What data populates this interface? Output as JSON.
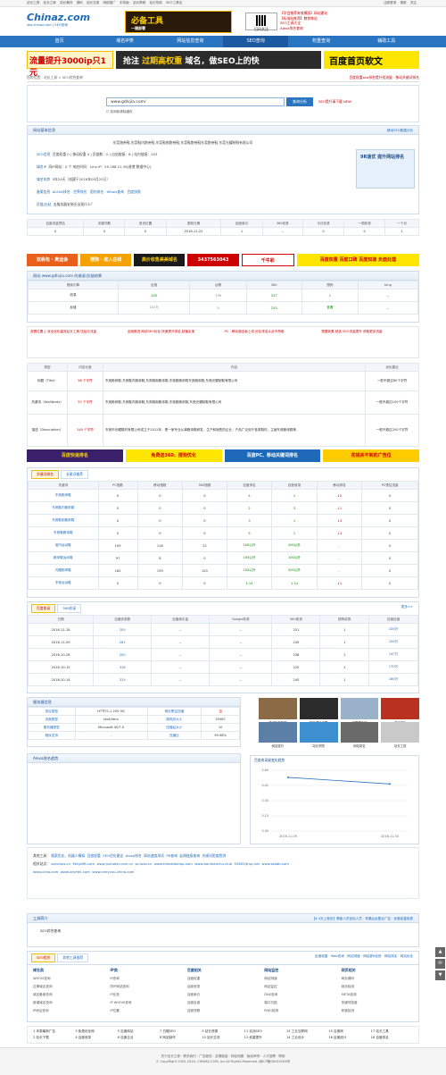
{
  "topbar": {
    "left": [
      "站长工具",
      "站长之家",
      "站长素材",
      "源码",
      "站长交易",
      "网络推广",
      "手机版",
      "站长帮助",
      "站长导航",
      "SEO工具包"
    ],
    "right": [
      "注册登录",
      "更新",
      "关注"
    ]
  },
  "header": {
    "logo_text": "Chinaz.com",
    "logo_sub": "seo.chinaz.com | SEO查询",
    "ad_title": "必备工具",
    "ad_sub": "一键部署",
    "qr_label": "扫码关注",
    "links": [
      "【学会推荐有效模版】网站建站",
      "【标准站推荐】教你做站",
      "SEO工具大全",
      "Alexa排名查询",
      "网站被K监控",
      "seo优化教程"
    ]
  },
  "nav": [
    "首页",
    "域名IP类",
    "网站信息查询",
    "SEO查询",
    "权重查询",
    "辅助工具"
  ],
  "banners": {
    "b1": "流量提升3000ip只1元",
    "b2_a": "抢注",
    "b2_b": "过期高权重",
    "b2_c": "域名，做SEO上的快",
    "b3": "百度首页软文"
  },
  "crumb": {
    "text": "您的位置：站长工具 > SEO综合查询",
    "right": "百度权重seo排名提升找流量 · 移动关键词排名"
  },
  "search": {
    "value": "www.gdlvjia.com/",
    "button": "查询分析",
    "note": "SEO提升请下载 NEW",
    "checkbox": "查询前清除缓存"
  },
  "basic": {
    "title": "网站基本信息",
    "right": "移动SEO数据分析",
    "keywords": "东莞跑帝鞋,东莞鞋内跑帝鞋,东莞鞋制跑帝鞋,东莞鞋跑帝鞋东莞跑帝鞋,东莞光耀制鞋有限公司",
    "seo_label": "SEO信息",
    "seo_text": "百度权重 0 | 移动权重 0 | 反链数：0 | 出站链接：8 | 站内链接：203",
    "ip_label": "域名IP",
    "ip_text": "同IP网站：0 个   响应时间：1ms   IP：59.188.21.39[香港 数据中心]",
    "age_label": "域名年龄",
    "age_text": "5年29天（创建于2016年05月25日）",
    "record_label": "备案信息",
    "record_text": "ALEXA排名 · 世界排名 · 国内排名 · Whois查询 · 百度快照",
    "speed_label": "反链/出站",
    "speed_text": "去服务器安装还出现什么？",
    "ad_box": "9R速优 提升网站排名"
  },
  "stats_table": {
    "headers": [
      "百度流量预估",
      "关键词数",
      "首页位置",
      "更新日期",
      "百度索引",
      "360收录",
      "今日收录",
      "一周收录",
      "一个月"
    ],
    "values": [
      "0",
      "0",
      "0",
      "2016-11-22",
      "1",
      "--",
      "0",
      "0",
      "1"
    ]
  },
  "ads_row1": [
    "双肩包 · 奥运会",
    "搜狗 · 收入在线",
    "高价收售美美域名",
    "3437563043",
    "千牛彩",
    "百度权重 百度口碑 百度知道 负面处理"
  ],
  "include": {
    "title": "网站 www.gdlvjia.com 的收录/反链结果",
    "headers": [
      "搜索引擎",
      "百度",
      "谷歌",
      "360",
      "搜狗",
      "bing"
    ],
    "rows": [
      [
        "收录",
        "205",
        "199",
        "257",
        "1",
        "--"
      ],
      [
        "反链",
        "102万",
        "0",
        "253",
        "查看",
        "--"
      ]
    ]
  },
  "promo": [
    "查看位置上 双全优化高效站长工具 伍拾元流量",
    "全面推进 网站SEO优化 快速提升排名 超值实惠",
    "PC - 移动端全面上线 优化排名从此不再难",
    "想要效果 就选 SEO流量提升 获取更多流量"
  ],
  "meta": {
    "headers": [
      "类型",
      "内容长度",
      "内容",
      "优化建议"
    ],
    "rows": [
      [
        "标题（Title）",
        "56 个字符",
        "东莞跑帝鞋,东莞鞋内跑帝鞋,东莞鞋制跑帝鞋,东莞鞋跑帝鞋东莞跑帝鞋,东莞光耀制鞋有限公司",
        "一般不超过80个字符"
      ],
      [
        "关键词（KeyWords）",
        "57 个字符",
        "东莞跑帝鞋,东莞鞋内跑帝鞋,东莞鞋制跑帝鞋,东莞鞋跑帝鞋,东莞光耀制鞋有限公司",
        "一般不超过100个字符"
      ],
      [
        "描述（Description）",
        "140 个字符",
        "东莞市光耀鞋材有限公司成立于2012年，是一家专业从事跑帝鞋研发、生产和销售的企业，产品广泛用于各类鞋材，主营东莞跑帝鞋等。",
        "一般不超过200个字符"
      ]
    ]
  },
  "ads_row2": [
    "百度快速排名",
    "免费送360、搜狗优化",
    "百度PC、移动关键词排名",
    "花钱买不到的广告位"
  ],
  "kw": {
    "tabs": [
      "关键词排名",
      "长尾词推荐"
    ],
    "headers": [
      "关键词",
      "PC指数",
      "移动指数",
      "360指数",
      "百度排名",
      "百度收录",
      "移动排名",
      "PC预估流量",
      "预估流量"
    ],
    "rows": [
      [
        "东莞跑帝鞋",
        "0",
        "0",
        "0",
        "4",
        "1",
        "↓2",
        "0"
      ],
      [
        "东莞鞋内跑帝鞋",
        "0",
        "0",
        "0",
        "2",
        "3",
        "↓1",
        "0"
      ],
      [
        "东莞鞋制跑帝鞋",
        "0",
        "0",
        "0",
        "3",
        "1",
        "↓3",
        "0"
      ],
      [
        "东莞鞋跑帝鞋",
        "0",
        "0",
        "0",
        "5",
        "1",
        "↓3",
        "0"
      ],
      [
        "室内运动鞋",
        "109",
        "118",
        "22",
        "100以外",
        "100以外",
        "-",
        "0"
      ],
      [
        "跑帝鞋运动鞋",
        "97",
        "8",
        "0",
        "100以外",
        "100以外",
        "-",
        "0"
      ],
      [
        "光耀跑帝鞋",
        "182",
        "159",
        "120",
        "100以外",
        "100以外",
        "-",
        "0"
      ],
      [
        "东莞运动鞋",
        "0",
        "0",
        "0",
        "1.14",
        "1.14",
        "↓1",
        "0"
      ]
    ]
  },
  "hist": {
    "tabs": [
      "百度收录",
      "360收录"
    ],
    "right": "更多>>",
    "headers": [
      "日期",
      "百度收录数",
      "百度索引量",
      "Google收录",
      "360收录",
      "搜狗收录",
      "百度反链"
    ],
    "rows": [
      [
        "2016-11-18",
        "205",
        "--",
        "--",
        "251",
        "1",
        "100万"
      ],
      [
        "2016-11-09",
        "261",
        "--",
        "--",
        "245",
        "1",
        "100万"
      ],
      [
        "2016-10-28",
        "200",
        "--",
        "--",
        "238",
        "1",
        "147万"
      ],
      [
        "2016-10-15",
        "316",
        "--",
        "--",
        "220",
        "1",
        "170万"
      ],
      [
        "2016-10-14",
        "315",
        "--",
        "--",
        "245",
        "1",
        "180万"
      ]
    ]
  },
  "server": {
    "title": "服务器信息",
    "rows": [
      [
        "协议类型",
        "HTTP/1.1 200 OK",
        "网页是否压缩",
        "否"
      ],
      [
        "页面类型",
        "text/html",
        "原网页大小",
        "55587"
      ],
      [
        "服务器类型",
        "Microsoft-IIS/7.0",
        "压缩后大小",
        "10"
      ],
      [
        "程序支持",
        "-",
        "压缩比",
        "99.98%"
      ]
    ],
    "thumbs": [
      "热门软件推荐",
      "精品源码下载",
      "中国建站师",
      "游戏排行",
      "网站技巧",
      "站长学院",
      "网站排名",
      "站长工具",
      "SEO优化工具",
      "网站建设",
      "网站Logo",
      "比价网"
    ]
  },
  "alexa": {
    "title": "Alexa排名趋势",
    "chart_title": "百度收录量变化趋势"
  },
  "chart_data": {
    "type": "line",
    "title": "百度收录量变化趋势",
    "x": [
      "2016-11-09",
      "2016-11-30"
    ],
    "values": [
      0.53,
      0.465
    ],
    "ylim": [
      0,
      0.6
    ]
  },
  "related": {
    "label": "其他工具：",
    "links": [
      "搜索优化、机器人模拟",
      "百度权重",
      "SEO优化建议",
      "Alexa排名",
      "网站速度测试",
      "PR查询",
      "友情链接查询",
      "关键词密度检测"
    ],
    "friend_label": "相关站点：",
    "friends": [
      "zoncloss.cn",
      "Ekhjo98.com",
      "www.juxhotel.com.cn",
      "sp.loza.cn",
      "www.thebestshop.com",
      "www.bonmanchu.club",
      "55605jtrup.net",
      "www.szabb.com",
      "www.clelo.com",
      "www.xzymfc.com",
      "www.cimyxxu-china.com"
    ]
  },
  "toolintro": {
    "title": "工具简介",
    "text": "SEO综合查询",
    "hot": "【4-3天上首页】黑客人员优化人员 · 苹果后台整合广告 · 优惠权重收费"
  },
  "foot_tabs": [
    "SEO相关",
    "其他工具推荐"
  ],
  "foot_right": "百度权重 · Web查询 · 网站测速 · 网站被K检测 · 网站排名 · 网站优化",
  "foot_cols": [
    {
      "title": "域名类",
      "items": [
        "WHOIS查询",
        "过期域名查询",
        "域名备案查询",
        "新增域名查询",
        "IP地址查询"
      ]
    },
    {
      "title": "IP类",
      "items": [
        "IP查询",
        "同IP网站查询",
        "IP反查",
        "IP WHOIS查询",
        "IP位置"
      ]
    },
    {
      "title": "百度相关",
      "items": [
        "百度权重",
        "百度收录",
        "百度索引",
        "百度反链",
        "百度快照"
      ]
    },
    {
      "title": "网站监控",
      "items": [
        "网站测速",
        "网站监控",
        "DNS查询",
        "端口扫描",
        "PING检测"
      ]
    },
    {
      "title": "网页相关",
      "items": [
        "网页源码",
        "网页检测",
        "META检测",
        "关键词密度",
        "死链检测"
      ]
    }
  ],
  "friendlinks": [
    "1 本周最新广告",
    "3 免费优化网",
    "5 百度网站",
    "7 白帽SEO",
    "9 站长资源",
    "11 实战SEO",
    "13 工业互联网",
    "15 百度网",
    "17 站长工具",
    "2 站长下载",
    "4 百度收录",
    "6 百度企业",
    "8 网站制作",
    "10 站长交流",
    "12 权重提升",
    "14 工业设计",
    "16 百度统计",
    "18 百度排名"
  ],
  "footer": {
    "line1": "关于站长之家 · 联系我们 · 广告服务 · 友情链接 · 网站地图 · 版权声明 · 人才招聘 · 帮助",
    "line2": "© CopyRight 2002-2016, CHINAZ.COM, Inc.All Rights Reserved. 闽ICP备08105208号"
  },
  "side_buttons": [
    "▲",
    "✉",
    "▼"
  ]
}
